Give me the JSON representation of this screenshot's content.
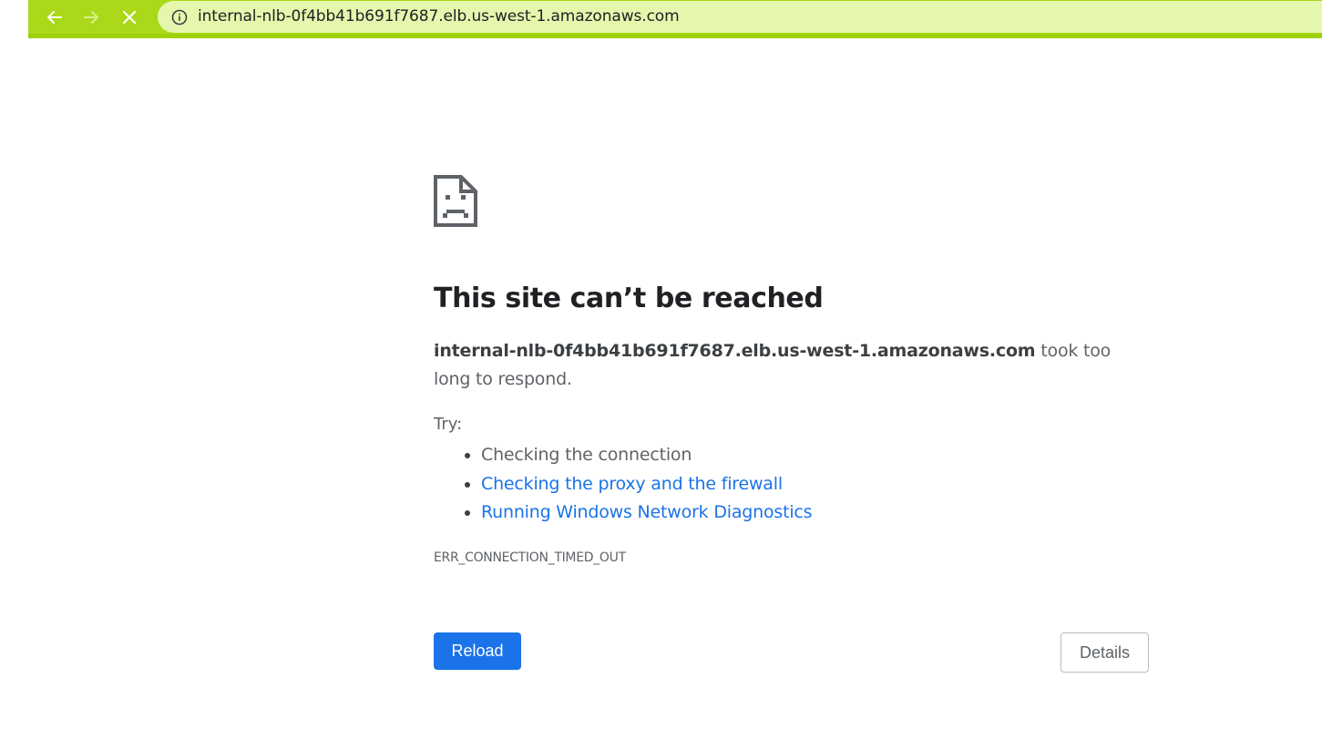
{
  "browser": {
    "url": "internal-nlb-0f4bb41b691f7687.elb.us-west-1.amazonaws.com",
    "icons": {
      "back": "arrow-left-icon",
      "forward": "arrow-right-icon",
      "stop": "close-icon",
      "info": "info-icon"
    },
    "colors": {
      "toolbar": "#a9d918",
      "omnibox": "#e5f7ad"
    }
  },
  "error_page": {
    "icon": "sad-page-icon",
    "title": "This site can’t be reached",
    "host": "internal-nlb-0f4bb41b691f7687.elb.us-west-1.amazonaws.com",
    "message_suffix": "took too long to respond.",
    "try_label": "Try:",
    "suggestions": [
      {
        "text": "Checking the connection",
        "is_link": false
      },
      {
        "text": "Checking the proxy and the firewall",
        "is_link": true
      },
      {
        "text": "Running Windows Network Diagnostics",
        "is_link": true
      }
    ],
    "error_code": "ERR_CONNECTION_TIMED_OUT",
    "buttons": {
      "reload": "Reload",
      "details": "Details"
    },
    "colors": {
      "link": "#1a73e8",
      "primary_button": "#1a73e8"
    }
  }
}
